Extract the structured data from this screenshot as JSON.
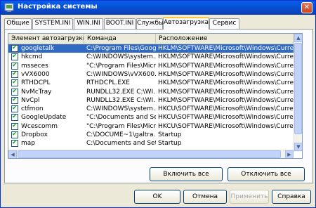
{
  "window": {
    "title": "Настройка системы"
  },
  "tabs": [
    {
      "label": "Общие"
    },
    {
      "label": "SYSTEM.INI"
    },
    {
      "label": "WIN.INI"
    },
    {
      "label": "BOOT.INI"
    },
    {
      "label": "Службы"
    },
    {
      "label": "Автозагрузка"
    },
    {
      "label": "Сервис"
    }
  ],
  "startup": {
    "columns": {
      "item": "Элемент автозагрузки",
      "command": "Команда",
      "location": "Расположение"
    },
    "rows": [
      {
        "item": "googletalk",
        "command": "C:\\Program Files\\Goog...",
        "location": "HKLM\\SOFTWARE\\Microsoft\\Windows\\CurrentVer...",
        "checked": true,
        "selected": true
      },
      {
        "item": "hkcmd",
        "command": "C:\\WINDOWS\\system...",
        "location": "HKLM\\SOFTWARE\\Microsoft\\Windows\\CurrentVer...",
        "checked": true
      },
      {
        "item": "msseces",
        "command": "\"C:\\Program Files\\Micr...",
        "location": "HKLM\\SOFTWARE\\Microsoft\\Windows\\CurrentVer...",
        "checked": true
      },
      {
        "item": "vVX6000",
        "command": "C:\\WINDOWS\\vVX600...",
        "location": "HKLM\\SOFTWARE\\Microsoft\\Windows\\CurrentVer...",
        "checked": true
      },
      {
        "item": "RTHDCPL",
        "command": "RTHDCPL.EXE",
        "location": "HKLM\\SOFTWARE\\Microsoft\\Windows\\CurrentVer...",
        "checked": true
      },
      {
        "item": "NvMcTray",
        "command": "RUNDLL32.EXE C:\\WI...",
        "location": "HKLM\\SOFTWARE\\Microsoft\\Windows\\CurrentVer...",
        "checked": true
      },
      {
        "item": "NvCpl",
        "command": "RUNDLL32.EXE C:\\WI...",
        "location": "HKLM\\SOFTWARE\\Microsoft\\Windows\\CurrentVer...",
        "checked": true
      },
      {
        "item": "ctfmon",
        "command": "C:\\WINDOWS\\system...",
        "location": "HKCU\\SOFTWARE\\Microsoft\\Windows\\CurrentVer...",
        "checked": true
      },
      {
        "item": "GoogleUpdate",
        "command": "\"C:\\Documents and Se...",
        "location": "HKCU\\SOFTWARE\\Microsoft\\Windows\\CurrentVer...",
        "checked": true
      },
      {
        "item": "Wcescomm",
        "command": "\"C:\\Program Files\\Micr...",
        "location": "HKCU\\SOFTWARE\\Microsoft\\Windows\\CurrentVer...",
        "checked": true
      },
      {
        "item": "Dropbox",
        "command": "C:\\DOCUME~1\\galtra...",
        "location": "Startup",
        "checked": true
      },
      {
        "item": "map",
        "command": "C:\\Documents and Set...",
        "location": "Startup",
        "checked": true
      }
    ]
  },
  "panel_buttons": {
    "enable_all": "Включить все",
    "disable_all": "Отключить все"
  },
  "dialog_buttons": {
    "ok": "OK",
    "cancel": "Отмена",
    "apply": "Применить",
    "help": "Справка"
  },
  "colors": {
    "selection": "#316ac5",
    "titlebar": "#0553d8",
    "tab_highlight": "#ffc73c"
  }
}
